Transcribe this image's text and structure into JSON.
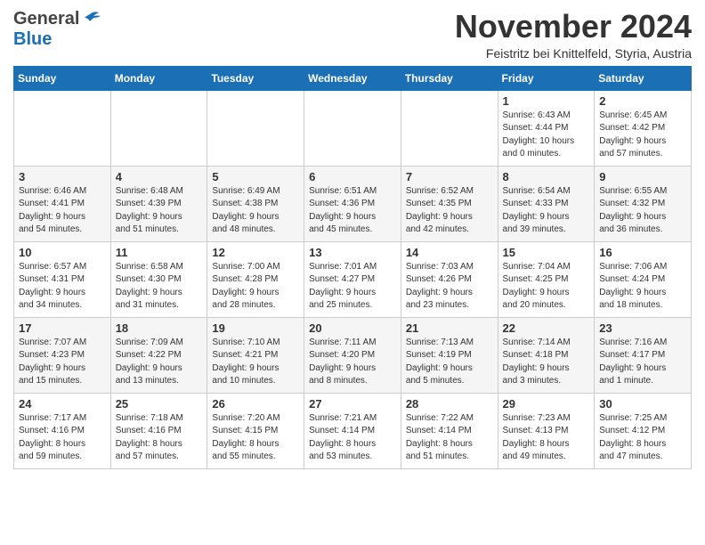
{
  "header": {
    "logo_general": "General",
    "logo_blue": "Blue",
    "month_year": "November 2024",
    "location": "Feistritz bei Knittelfeld, Styria, Austria"
  },
  "weekdays": [
    "Sunday",
    "Monday",
    "Tuesday",
    "Wednesday",
    "Thursday",
    "Friday",
    "Saturday"
  ],
  "weeks": [
    [
      {
        "day": "",
        "info": ""
      },
      {
        "day": "",
        "info": ""
      },
      {
        "day": "",
        "info": ""
      },
      {
        "day": "",
        "info": ""
      },
      {
        "day": "",
        "info": ""
      },
      {
        "day": "1",
        "info": "Sunrise: 6:43 AM\nSunset: 4:44 PM\nDaylight: 10 hours\nand 0 minutes."
      },
      {
        "day": "2",
        "info": "Sunrise: 6:45 AM\nSunset: 4:42 PM\nDaylight: 9 hours\nand 57 minutes."
      }
    ],
    [
      {
        "day": "3",
        "info": "Sunrise: 6:46 AM\nSunset: 4:41 PM\nDaylight: 9 hours\nand 54 minutes."
      },
      {
        "day": "4",
        "info": "Sunrise: 6:48 AM\nSunset: 4:39 PM\nDaylight: 9 hours\nand 51 minutes."
      },
      {
        "day": "5",
        "info": "Sunrise: 6:49 AM\nSunset: 4:38 PM\nDaylight: 9 hours\nand 48 minutes."
      },
      {
        "day": "6",
        "info": "Sunrise: 6:51 AM\nSunset: 4:36 PM\nDaylight: 9 hours\nand 45 minutes."
      },
      {
        "day": "7",
        "info": "Sunrise: 6:52 AM\nSunset: 4:35 PM\nDaylight: 9 hours\nand 42 minutes."
      },
      {
        "day": "8",
        "info": "Sunrise: 6:54 AM\nSunset: 4:33 PM\nDaylight: 9 hours\nand 39 minutes."
      },
      {
        "day": "9",
        "info": "Sunrise: 6:55 AM\nSunset: 4:32 PM\nDaylight: 9 hours\nand 36 minutes."
      }
    ],
    [
      {
        "day": "10",
        "info": "Sunrise: 6:57 AM\nSunset: 4:31 PM\nDaylight: 9 hours\nand 34 minutes."
      },
      {
        "day": "11",
        "info": "Sunrise: 6:58 AM\nSunset: 4:30 PM\nDaylight: 9 hours\nand 31 minutes."
      },
      {
        "day": "12",
        "info": "Sunrise: 7:00 AM\nSunset: 4:28 PM\nDaylight: 9 hours\nand 28 minutes."
      },
      {
        "day": "13",
        "info": "Sunrise: 7:01 AM\nSunset: 4:27 PM\nDaylight: 9 hours\nand 25 minutes."
      },
      {
        "day": "14",
        "info": "Sunrise: 7:03 AM\nSunset: 4:26 PM\nDaylight: 9 hours\nand 23 minutes."
      },
      {
        "day": "15",
        "info": "Sunrise: 7:04 AM\nSunset: 4:25 PM\nDaylight: 9 hours\nand 20 minutes."
      },
      {
        "day": "16",
        "info": "Sunrise: 7:06 AM\nSunset: 4:24 PM\nDaylight: 9 hours\nand 18 minutes."
      }
    ],
    [
      {
        "day": "17",
        "info": "Sunrise: 7:07 AM\nSunset: 4:23 PM\nDaylight: 9 hours\nand 15 minutes."
      },
      {
        "day": "18",
        "info": "Sunrise: 7:09 AM\nSunset: 4:22 PM\nDaylight: 9 hours\nand 13 minutes."
      },
      {
        "day": "19",
        "info": "Sunrise: 7:10 AM\nSunset: 4:21 PM\nDaylight: 9 hours\nand 10 minutes."
      },
      {
        "day": "20",
        "info": "Sunrise: 7:11 AM\nSunset: 4:20 PM\nDaylight: 9 hours\nand 8 minutes."
      },
      {
        "day": "21",
        "info": "Sunrise: 7:13 AM\nSunset: 4:19 PM\nDaylight: 9 hours\nand 5 minutes."
      },
      {
        "day": "22",
        "info": "Sunrise: 7:14 AM\nSunset: 4:18 PM\nDaylight: 9 hours\nand 3 minutes."
      },
      {
        "day": "23",
        "info": "Sunrise: 7:16 AM\nSunset: 4:17 PM\nDaylight: 9 hours\nand 1 minute."
      }
    ],
    [
      {
        "day": "24",
        "info": "Sunrise: 7:17 AM\nSunset: 4:16 PM\nDaylight: 8 hours\nand 59 minutes."
      },
      {
        "day": "25",
        "info": "Sunrise: 7:18 AM\nSunset: 4:16 PM\nDaylight: 8 hours\nand 57 minutes."
      },
      {
        "day": "26",
        "info": "Sunrise: 7:20 AM\nSunset: 4:15 PM\nDaylight: 8 hours\nand 55 minutes."
      },
      {
        "day": "27",
        "info": "Sunrise: 7:21 AM\nSunset: 4:14 PM\nDaylight: 8 hours\nand 53 minutes."
      },
      {
        "day": "28",
        "info": "Sunrise: 7:22 AM\nSunset: 4:14 PM\nDaylight: 8 hours\nand 51 minutes."
      },
      {
        "day": "29",
        "info": "Sunrise: 7:23 AM\nSunset: 4:13 PM\nDaylight: 8 hours\nand 49 minutes."
      },
      {
        "day": "30",
        "info": "Sunrise: 7:25 AM\nSunset: 4:12 PM\nDaylight: 8 hours\nand 47 minutes."
      }
    ]
  ]
}
